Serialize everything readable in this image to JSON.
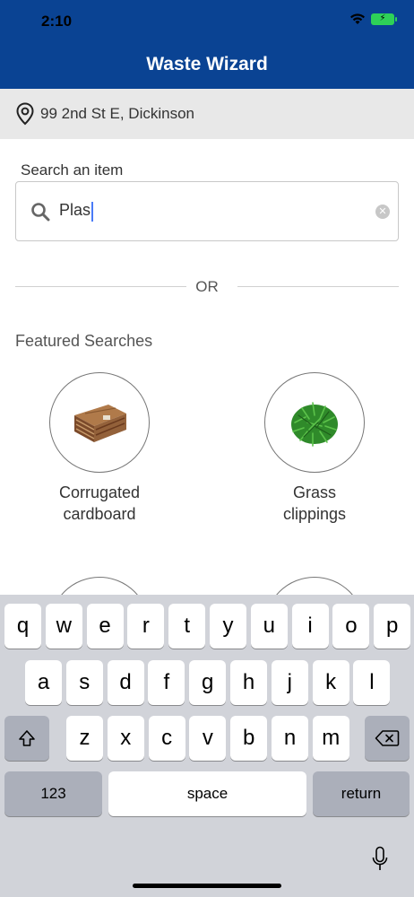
{
  "status_bar": {
    "time": "2:10"
  },
  "header": {
    "title": "Waste Wizard"
  },
  "location": {
    "address": "99 2nd St E, Dickinson"
  },
  "search": {
    "label": "Search an item",
    "value": "Plas"
  },
  "divider": {
    "text": "OR"
  },
  "featured": {
    "title": "Featured Searches",
    "items": [
      {
        "label": "Corrugated\ncardboard",
        "icon": "cardboard-image"
      },
      {
        "label": "Grass\nclippings",
        "icon": "grass-image"
      }
    ]
  },
  "keyboard": {
    "row1": [
      "q",
      "w",
      "e",
      "r",
      "t",
      "y",
      "u",
      "i",
      "o",
      "p"
    ],
    "row2": [
      "a",
      "s",
      "d",
      "f",
      "g",
      "h",
      "j",
      "k",
      "l"
    ],
    "row3": [
      "z",
      "x",
      "c",
      "v",
      "b",
      "n",
      "m"
    ],
    "numbers_label": "123",
    "space_label": "space",
    "return_label": "return"
  },
  "colors": {
    "header": "#0a4393",
    "location_bar": "#e8e8e8",
    "keyboard_bg": "#d1d3d9"
  }
}
